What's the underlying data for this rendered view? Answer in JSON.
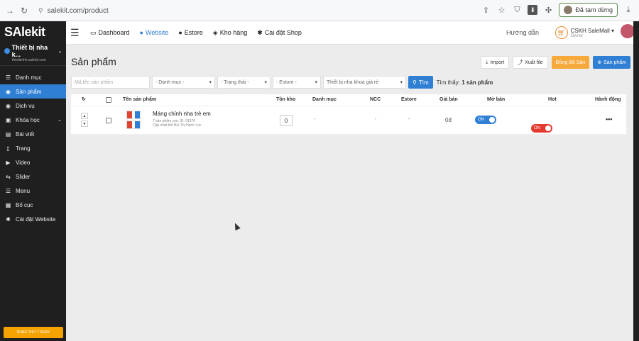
{
  "browser": {
    "url": "salekit.com/product",
    "paused_label": "Đã tạm dừng"
  },
  "sidebar": {
    "logo": "SAlekit",
    "shop_name": "Thiết bị nha k...",
    "shop_url": "thietbinhk.salekit.com",
    "items": [
      {
        "label": "Danh mục",
        "icon": "list-icon"
      },
      {
        "label": "Sản phẩm",
        "icon": "product-icon"
      },
      {
        "label": "Dịch vụ",
        "icon": "service-icon"
      },
      {
        "label": "Khóa học",
        "icon": "course-icon"
      },
      {
        "label": "Bài viết",
        "icon": "article-icon"
      },
      {
        "label": "Trang",
        "icon": "page-icon"
      },
      {
        "label": "Video",
        "icon": "video-icon"
      },
      {
        "label": "Slider",
        "icon": "slider-icon"
      },
      {
        "label": "Menu",
        "icon": "menu-icon"
      },
      {
        "label": "Bố cục",
        "icon": "layout-icon"
      },
      {
        "label": "Cài đặt Website",
        "icon": "gear-icon"
      }
    ],
    "trial_label": "DÙNG THỬ 7 NGÀY"
  },
  "topnav": {
    "items": [
      {
        "label": "Dashboard"
      },
      {
        "label": "Website"
      },
      {
        "label": "Estore"
      },
      {
        "label": "Kho hàng"
      },
      {
        "label": "Cài đặt Shop"
      }
    ],
    "guide": "Hướng dẫn",
    "user_name": "CSKH SaleMall",
    "user_role": "Owner"
  },
  "page": {
    "title": "Sản phẩm",
    "actions": {
      "import": "Import",
      "export": "Xuất file",
      "sync": "Đồng Bộ Sàn",
      "add": "Sản phẩm"
    },
    "filters": {
      "search_placeholder": "Mã,tên sản phẩm",
      "category": "- Danh mục -",
      "status": "- Trạng thái -",
      "estore": "- Estore -",
      "tag": "Thiết bị nha khoa giá rẻ",
      "search_btn": "Tìm",
      "found_prefix": "Tìm thấy:",
      "found_count": "1 sản phẩm"
    },
    "table": {
      "headers": {
        "name": "Tên sản phẩm",
        "stock": "Tồn kho",
        "category": "Danh mục",
        "ncc": "NCC",
        "estore": "Estore",
        "price": "Giá bán",
        "sale": "Mở bán",
        "hot": "Hot",
        "actions": "Hành động"
      },
      "rows": [
        {
          "name": "Máng chỉnh nha trẻ em",
          "sub": "7 sản phẩm con. ID: 91576",
          "updated": "Cập nhật bởi Bùi Thị Hạnh Lúc",
          "stock": "0",
          "category": "-",
          "ncc": "-",
          "estore": "-",
          "price": "0đ",
          "sale": "ON",
          "hot": "ON",
          "actions": "•••"
        }
      ]
    }
  }
}
